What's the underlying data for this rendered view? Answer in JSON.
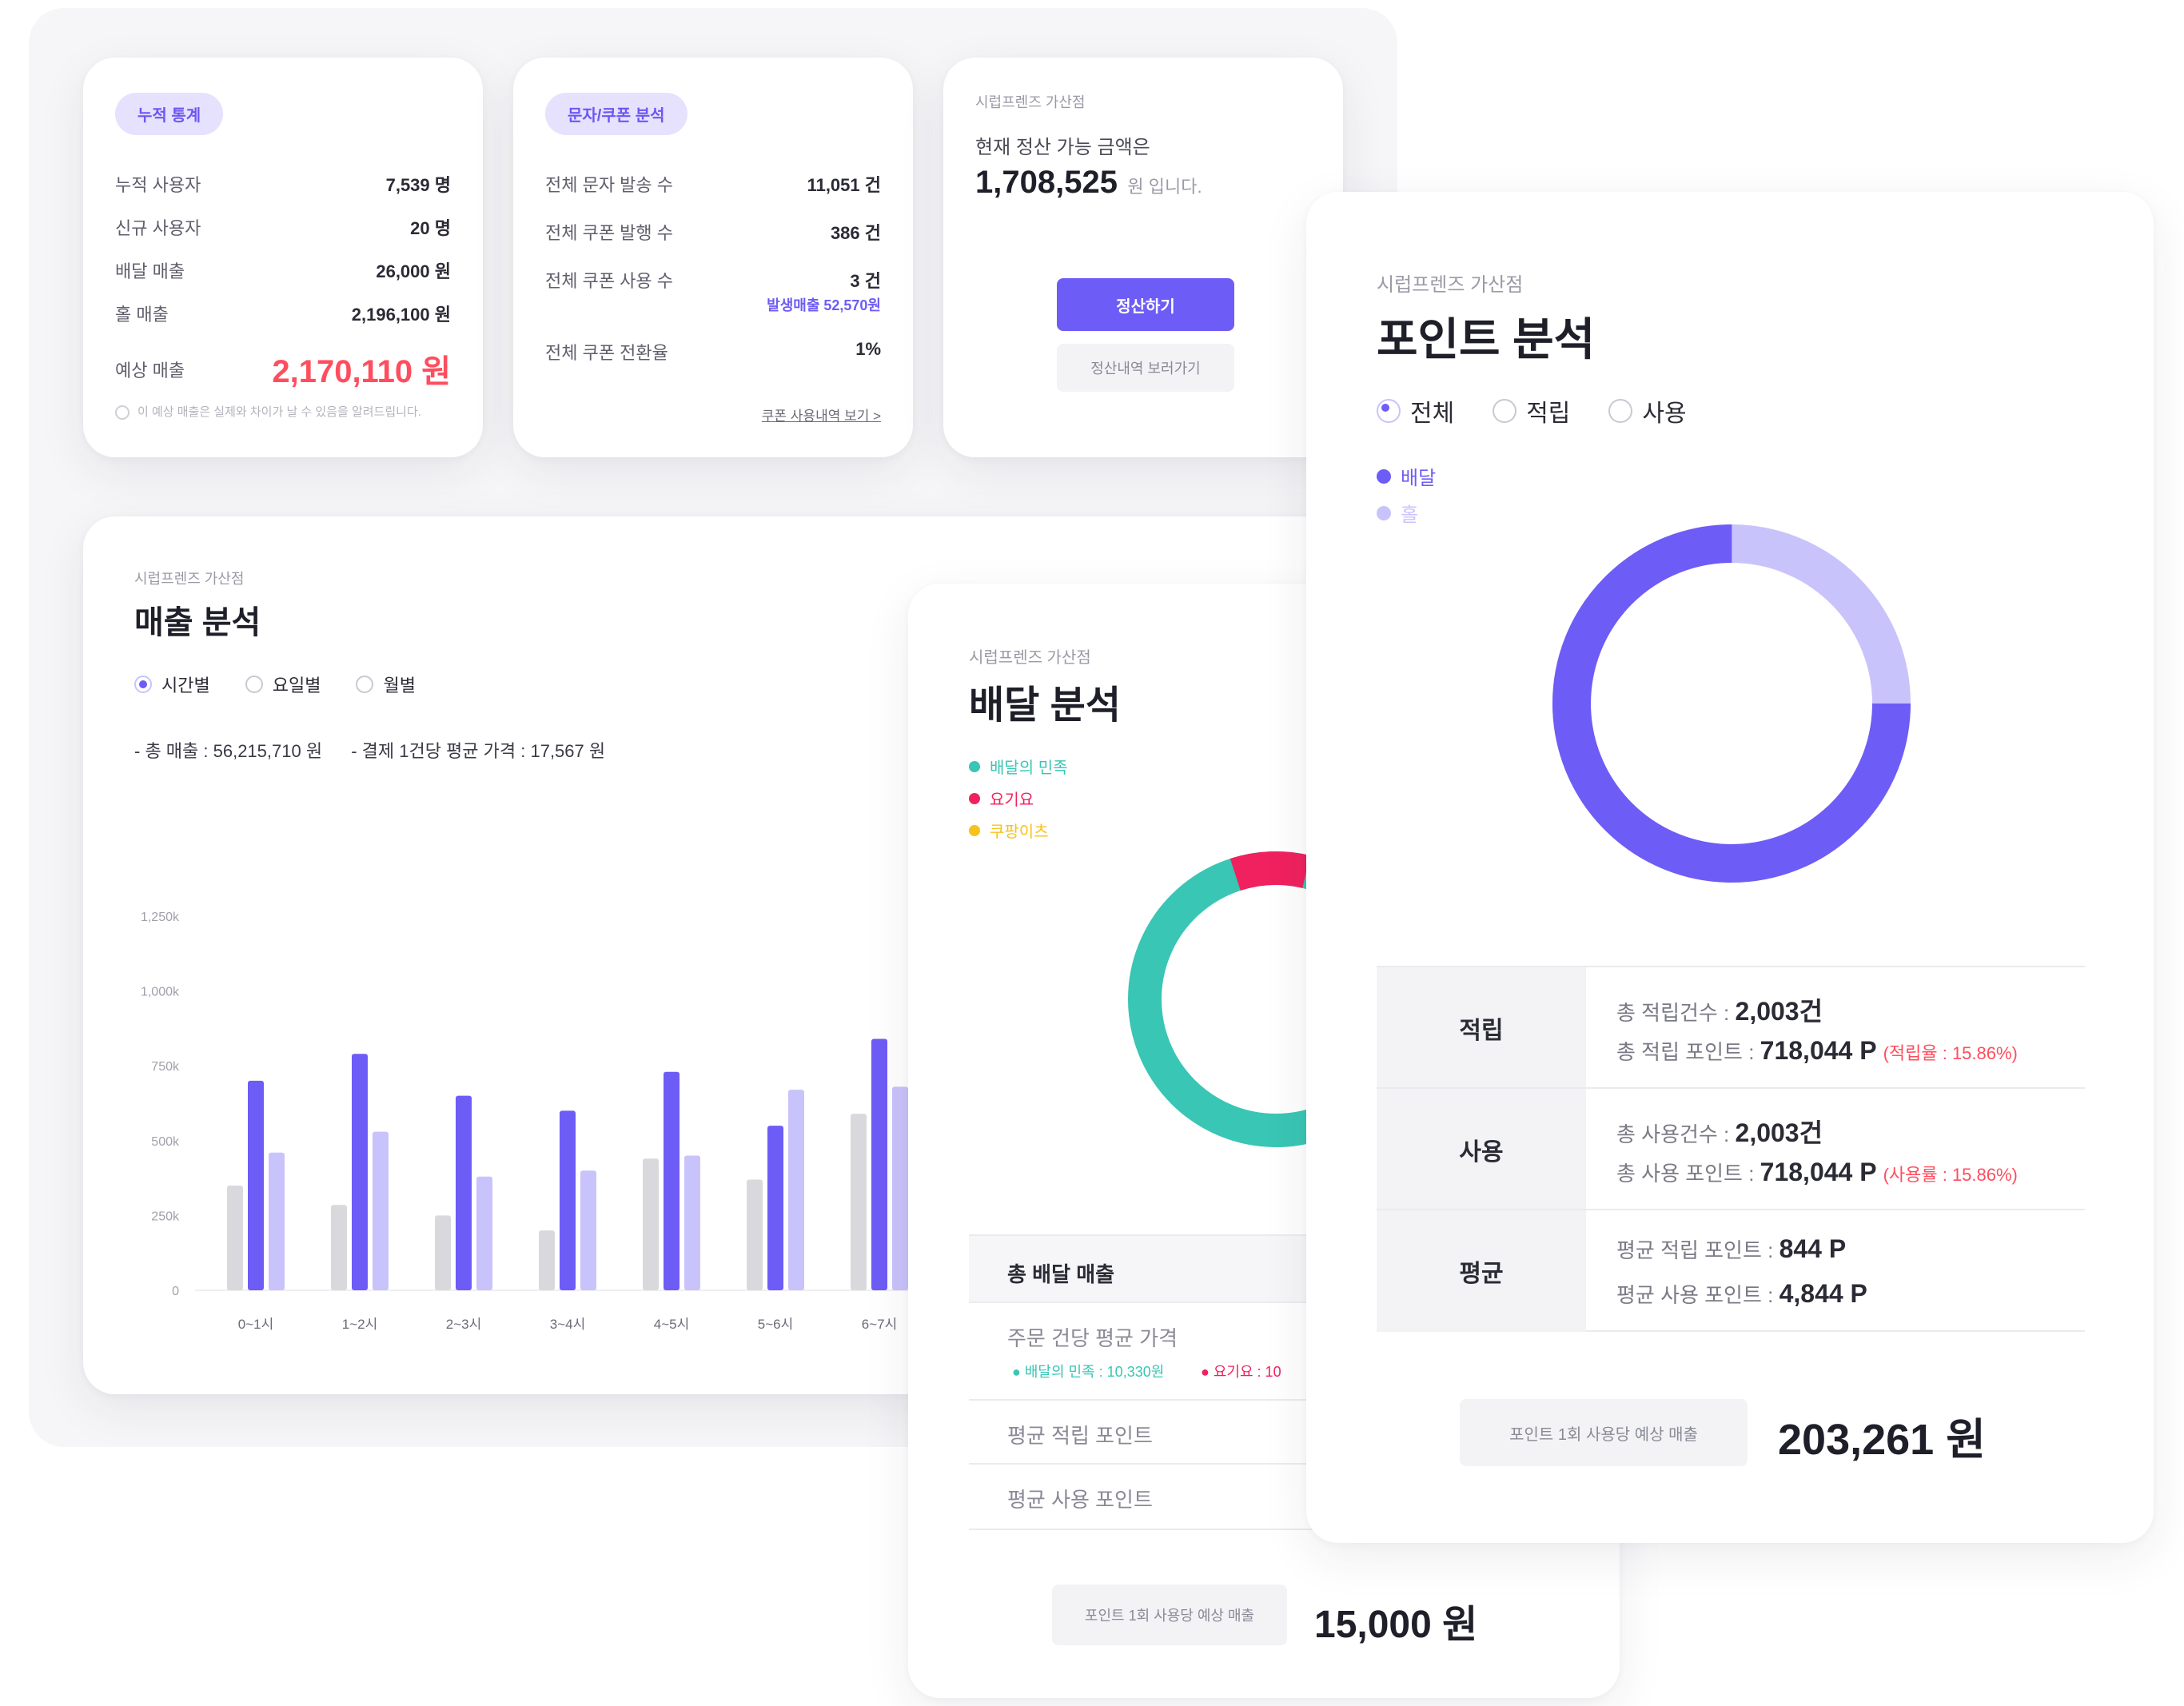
{
  "colors": {
    "accent": "#6e5cf6",
    "accent_light": "#c9c3fb",
    "gray_bar": "#d9d9dd",
    "red": "#ff4d5e",
    "teal": "#39c6b4",
    "pink": "#f0215e",
    "yellow": "#f7c21b"
  },
  "card_stats": {
    "badge": "누적 통계",
    "rows": [
      {
        "label": "누적 사용자",
        "value": "7,539 명"
      },
      {
        "label": "신규 사용자",
        "value": "20 명"
      },
      {
        "label": "배달 매출",
        "value": "26,000 원"
      },
      {
        "label": "홀 매출",
        "value": "2,196,100 원"
      }
    ],
    "expected_label": "예상 매출",
    "expected_value": "2,170,110 원",
    "note": "이 예상 매출은 실제와 차이가 날 수 있음을 알려드립니다."
  },
  "card_coupon": {
    "badge": "문자/쿠폰 분석",
    "rows": [
      {
        "label": "전체 문자 발송 수",
        "value": "11,051 건"
      },
      {
        "label": "전체 쿠폰 발행 수",
        "value": "386 건"
      },
      {
        "label": "전체 쿠폰 사용 수",
        "value": "3 건"
      },
      {
        "label": "전체 쿠폰 전환율",
        "value": "1%"
      }
    ],
    "sub_value": "발생매출 52,570원",
    "link": "쿠폰 사용내역 보기 >"
  },
  "card_settle": {
    "store": "시럽프렌즈 가산점",
    "prompt": "현재 정산 가능 금액은",
    "amount": "1,708,525",
    "suffix": "원 입니다.",
    "primary_button": "정산하기",
    "secondary_button": "정산내역 보러가기"
  },
  "sales": {
    "store": "시럽프렌즈 가산점",
    "title": "매출 분석",
    "radios": [
      {
        "label": "시간별",
        "selected": true
      },
      {
        "label": "요일별",
        "selected": false
      },
      {
        "label": "월별",
        "selected": false
      }
    ],
    "summary_total": "- 총 매출 : 56,215,710 원",
    "summary_avg": "- 결제 1건당 평균 가격 : 17,567 원"
  },
  "chart_data": {
    "type": "bar",
    "title": "",
    "xlabel": "",
    "ylabel": "",
    "y_tick_labels": [
      "0",
      "250k",
      "500k",
      "750k",
      "1,000k",
      "1,250k"
    ],
    "ylim": [
      0,
      1250000
    ],
    "grid": false,
    "categories": [
      "0~1시",
      "1~2시",
      "2~3시",
      "3~4시",
      "4~5시",
      "5~6시",
      "6~7시"
    ],
    "series": [
      {
        "color": "#d9d9dd",
        "values": [
          350000,
          285000,
          250000,
          200000,
          440000,
          370000,
          590000
        ]
      },
      {
        "color": "#6e5cf6",
        "values": [
          700000,
          790000,
          650000,
          600000,
          730000,
          550000,
          840000
        ]
      },
      {
        "color": "#c9c3fb",
        "values": [
          460000,
          530000,
          380000,
          400000,
          450000,
          670000,
          680000
        ]
      }
    ]
  },
  "delivery": {
    "store": "시럽프렌즈 가산점",
    "title": "배달 분석",
    "legend": [
      {
        "label": "배달의 민족",
        "color": "#39c6b4"
      },
      {
        "label": "요기요",
        "color": "#f0215e"
      },
      {
        "label": "쿠팡이츠",
        "color": "#f7c21b"
      }
    ],
    "total_label": "총 배달 매출",
    "avg_price_label": "주문 건당 평균 가격",
    "avg_baemin": "● 배달의 민족 : 10,330원",
    "avg_yogiyo": "● 요기요 : 10",
    "avg_earn_label": "평균 적립 포인트",
    "avg_use_label": "평균 사용 포인트",
    "footer_label": "포인트 1회 사용당 예상 매출",
    "footer_value": "15,000 원"
  },
  "points": {
    "store": "시럽프렌즈 가산점",
    "title": "포인트 분석",
    "radios": [
      {
        "label": "전체",
        "selected": true
      },
      {
        "label": "적립",
        "selected": false
      },
      {
        "label": "사용",
        "selected": false
      }
    ],
    "legend": [
      {
        "label": "배달",
        "color": "#6e5cf6"
      },
      {
        "label": "홀",
        "color": "#c9c3fb"
      }
    ],
    "donut_share": 0.75,
    "rows": [
      {
        "head": "적립",
        "line1_label": "총 적립건수 :",
        "line1_value": "2,003건",
        "line2_label": "총 적립 포인트 :",
        "line2_value": "718,044 P",
        "line2_extra": "(적립율 : 15.86%)"
      },
      {
        "head": "사용",
        "line1_label": "총 사용건수 :",
        "line1_value": "2,003건",
        "line2_label": "총 사용 포인트 :",
        "line2_value": "718,044 P",
        "line2_extra": "(사용률 : 15.86%)"
      },
      {
        "head": "평균",
        "line1_label": "평균 적립 포인트 :",
        "line1_value": "844 P",
        "line2_label": "평균 사용 포인트 :",
        "line2_value": "4,844 P",
        "line2_extra": ""
      }
    ],
    "footer_label": "포인트 1회 사용당 예상 매출",
    "footer_value": "203,261 원"
  }
}
